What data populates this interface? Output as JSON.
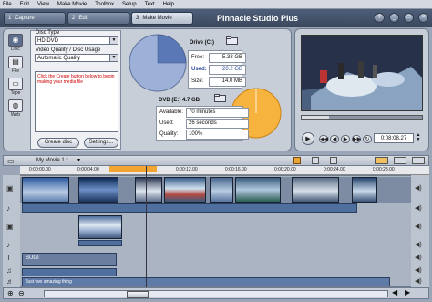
{
  "menu": [
    "File",
    "Edit",
    "View",
    "Make Movie",
    "Toolbox",
    "Setup",
    "Text",
    "Help"
  ],
  "tabs": [
    {
      "number": "1",
      "label": "Capture"
    },
    {
      "number": "2",
      "label": "Edit"
    },
    {
      "number": "3",
      "label": "Make Movie"
    }
  ],
  "app_title": "Pinnacle Studio Plus",
  "window_buttons": [
    "?",
    "_",
    "□",
    "×"
  ],
  "left_icons": [
    {
      "label": "Disc",
      "icon": "disc-icon"
    },
    {
      "label": "File",
      "icon": "file-icon"
    },
    {
      "label": "Tape",
      "icon": "tape-icon"
    },
    {
      "label": "Web",
      "icon": "web-icon"
    }
  ],
  "disc_settings": {
    "disc_type_label": "Disc Type",
    "disc_type_value": "HD DVD",
    "quality_label": "Video Quality / Disc Usage",
    "quality_value": "Automatic Quality",
    "message": "Click the Create button below to begin making your media file",
    "create_button": "Create disc",
    "settings_button": "Settings..."
  },
  "drive": {
    "label": "Drive (C:)",
    "free_label": "Free:",
    "free_value": "5.38 GB",
    "used_label": "Used:",
    "used_value": "20.2 GB",
    "size_label": "Size:",
    "size_value": "14.0 MB",
    "pie_used_fraction": 0.25
  },
  "dvd": {
    "label": "DVD (E:) 4.7 GB",
    "available_label": "Available:",
    "available_value": "70 minutes",
    "used_label": "Used:",
    "used_value": "26 seconds",
    "quality_label": "Quality:",
    "quality_value": "100%"
  },
  "player": {
    "timecode": "0:08:08.27",
    "progress_fraction": 0.23
  },
  "timeline": {
    "title": "My Movie 1 *",
    "ticks": [
      "0:00:00.00",
      "0:00:04.00",
      "0:00:08.00",
      "0:00:12.00",
      "0:00:16.00",
      "0:00:20.00",
      "0:00:24.00",
      "0:00:28.00"
    ],
    "title_overlay_text": "SUGI",
    "caption_text": "Just two amazing thing"
  },
  "colors": {
    "title_bar": "#3a475d",
    "pie_free": "#5a78b5",
    "pie_used_orange": "#f6a93b",
    "accent_orange": "#f4a430"
  }
}
